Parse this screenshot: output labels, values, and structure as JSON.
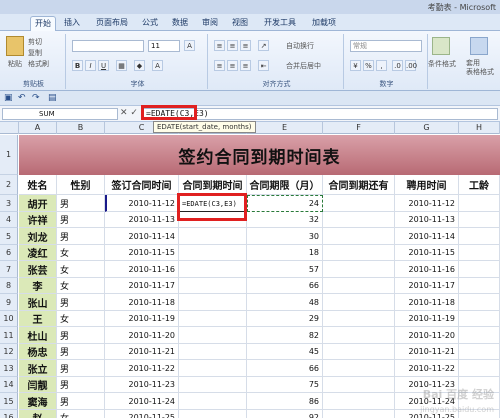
{
  "window": {
    "title": "考勤表 - Microsoft"
  },
  "tabs": [
    "开始",
    "插入",
    "页面布局",
    "公式",
    "数据",
    "审阅",
    "视图",
    "开发工具",
    "加载项"
  ],
  "ribbon": {
    "paste": "粘贴",
    "cut": "剪切",
    "copy": "复制",
    "format_painter": "格式刷",
    "font_size": "11",
    "wrap_text": "自动换行",
    "merge_center": "合并后居中",
    "number_format": "常规",
    "percent": "%",
    "comma": ",",
    "conditional_format": "条件格式",
    "table_format": "套用\n表格格式",
    "groups": [
      "剪贴板",
      "字体",
      "对齐方式",
      "数字"
    ]
  },
  "formula_bar": {
    "name_box": "SUM",
    "formula": "=EDATE(C3,E3)",
    "tooltip": "EDATE(start_date, months)"
  },
  "columns": [
    "A",
    "B",
    "C",
    "D",
    "E",
    "F",
    "G",
    "H"
  ],
  "sheet": {
    "title": "签约合同到期时间表",
    "headers": [
      "姓名",
      "性别",
      "签订合同时间",
      "合同到期时间",
      "合同期限（月）",
      "合同到期还有",
      "聘用时间",
      "工龄"
    ],
    "editing_cell": "=EDATE(C3,E3)",
    "rows": [
      {
        "row": "3",
        "name": "胡开",
        "gender": "男",
        "signed": "2010-11-12",
        "months": "24",
        "hired": "2010-11-12"
      },
      {
        "row": "4",
        "name": "许祥",
        "gender": "男",
        "signed": "2010-11-13",
        "months": "32",
        "hired": "2010-11-13"
      },
      {
        "row": "5",
        "name": "刘龙",
        "gender": "男",
        "signed": "2010-11-14",
        "months": "30",
        "hired": "2010-11-14"
      },
      {
        "row": "6",
        "name": "凌红",
        "gender": "女",
        "signed": "2010-11-15",
        "months": "18",
        "hired": "2010-11-15"
      },
      {
        "row": "7",
        "name": "张芸",
        "gender": "女",
        "signed": "2010-11-16",
        "months": "57",
        "hired": "2010-11-16"
      },
      {
        "row": "8",
        "name": "李",
        "gender": "女",
        "signed": "2010-11-17",
        "months": "66",
        "hired": "2010-11-17"
      },
      {
        "row": "9",
        "name": "张山",
        "gender": "男",
        "signed": "2010-11-18",
        "months": "48",
        "hired": "2010-11-18"
      },
      {
        "row": "10",
        "name": "王",
        "gender": "女",
        "signed": "2010-11-19",
        "months": "29",
        "hired": "2010-11-19"
      },
      {
        "row": "11",
        "name": "杜山",
        "gender": "男",
        "signed": "2010-11-20",
        "months": "82",
        "hired": "2010-11-20"
      },
      {
        "row": "12",
        "name": "杨忠",
        "gender": "男",
        "signed": "2010-11-21",
        "months": "45",
        "hired": "2010-11-21"
      },
      {
        "row": "13",
        "name": "张立",
        "gender": "男",
        "signed": "2010-11-22",
        "months": "66",
        "hired": "2010-11-22"
      },
      {
        "row": "14",
        "name": "闫靓",
        "gender": "男",
        "signed": "2010-11-23",
        "months": "75",
        "hired": "2010-11-23"
      },
      {
        "row": "15",
        "name": "窦海",
        "gender": "男",
        "signed": "2010-11-24",
        "months": "86",
        "hired": "2010-11-24"
      },
      {
        "row": "16",
        "name": "赵",
        "gender": "女",
        "signed": "2010-11-25",
        "months": "92",
        "hired": "2010-11-25"
      }
    ]
  },
  "row_labels": {
    "title_row": "1",
    "header_row": "2"
  },
  "watermark": {
    "main": "Bai 百度 经验",
    "sub": "jingyan.baidu.com"
  },
  "colors": {
    "title_band": "#c07a84",
    "name_fill": "#dbe9b8",
    "highlight": "#e02020"
  }
}
